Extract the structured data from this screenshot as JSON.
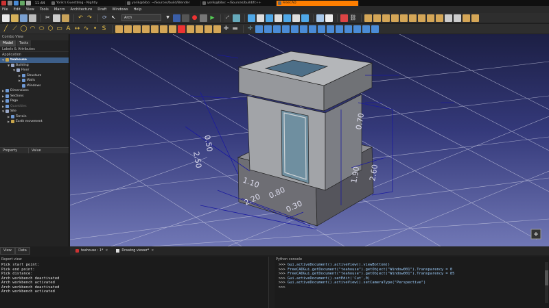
{
  "taskbar": {
    "clock": "11:44",
    "tasks": [
      {
        "label": "Yorik's Guestblog - Nightly",
        "active": false
      },
      {
        "label": "yorik@bibo: ~/Sources/build/Blender",
        "active": false
      },
      {
        "label": "yorik@bibo: ~/Sources/build/fc++",
        "active": false
      },
      {
        "label": "FreeCAD",
        "active": true
      }
    ]
  },
  "menubar": [
    "File",
    "Edit",
    "View",
    "Tools",
    "Macro",
    "Architecture",
    "Draft",
    "Windows",
    "Help"
  ],
  "toolbar": {
    "workbench": "Arch"
  },
  "left_panel": {
    "title": "Combo View",
    "tabs": [
      "Model",
      "Tasks"
    ],
    "section": "Labels & Attributes",
    "app_label": "Application",
    "tree": [
      {
        "label": "teahouse",
        "level": 0,
        "arrow": "▼",
        "icon": "#c9a64b",
        "style": "root"
      },
      {
        "label": "Building",
        "level": 1,
        "arrow": "▼",
        "icon": "#9aa8c8",
        "style": ""
      },
      {
        "label": "Floor",
        "level": 2,
        "arrow": "▼",
        "icon": "#9aa8c8",
        "style": ""
      },
      {
        "label": "Structure",
        "level": 3,
        "arrow": "▶",
        "icon": "#6f9ad6",
        "style": ""
      },
      {
        "label": "Walls",
        "level": 3,
        "arrow": "▶",
        "icon": "#6f9ad6",
        "style": ""
      },
      {
        "label": "Windows",
        "level": 3,
        "arrow": "",
        "icon": "#6f9ad6",
        "style": ""
      },
      {
        "label": "Dimensions",
        "level": 0,
        "arrow": "▶",
        "icon": "#6f9ad6",
        "style": ""
      },
      {
        "label": "Sections",
        "level": 0,
        "arrow": "▶",
        "icon": "#6f9ad6",
        "style": ""
      },
      {
        "label": "Page",
        "level": 0,
        "arrow": "▶",
        "icon": "#6f9ad6",
        "style": ""
      },
      {
        "label": "Quantities",
        "level": 0,
        "arrow": "▶",
        "icon": "#6f9ad6",
        "style": "dim"
      },
      {
        "label": "Site",
        "level": 0,
        "arrow": "▼",
        "icon": "#9aa8c8",
        "style": ""
      },
      {
        "label": "Terrain",
        "level": 1,
        "arrow": "▶",
        "icon": "#6f9ad6",
        "style": ""
      },
      {
        "label": "Earth movement",
        "level": 1,
        "arrow": "▶",
        "icon": "#c9a64b",
        "style": ""
      }
    ],
    "property_header": [
      "Property",
      "Value"
    ],
    "bottom_tabs": [
      "View",
      "Data"
    ]
  },
  "viewport": {
    "dimensions": [
      "0.50",
      "2.50",
      "0.70",
      "2.60",
      "1.90",
      "1.10",
      "2.20",
      "0.80",
      "0.30"
    ]
  },
  "doc_tabs": [
    "teahouse : 1*",
    "Drawing viewer*"
  ],
  "report_view": {
    "title": "Report view",
    "lines": [
      "Pick start point:",
      "Pick end point:",
      "Pick distance:",
      "Arch workbench deactivated",
      "Arch workbench activated",
      "Arch workbench deactivated",
      "Arch workbench activated"
    ]
  },
  "python_console": {
    "title": "Python console",
    "prompt": ">>>",
    "commands": [
      "Gui.activeDocument().activeView().viewBottom()",
      "FreeCADGui.getDocument(\"teahouse\").getObject(\"Window001\").Transparency = 0",
      "FreeCADGui.getDocument(\"teahouse\").getObject(\"Window001\").Transparency = 85",
      "Gui.activeDocument().setEdit('Cut',0)",
      "Gui.activeDocument().activeView().setCameraType(\"Perspective\")",
      ""
    ]
  }
}
